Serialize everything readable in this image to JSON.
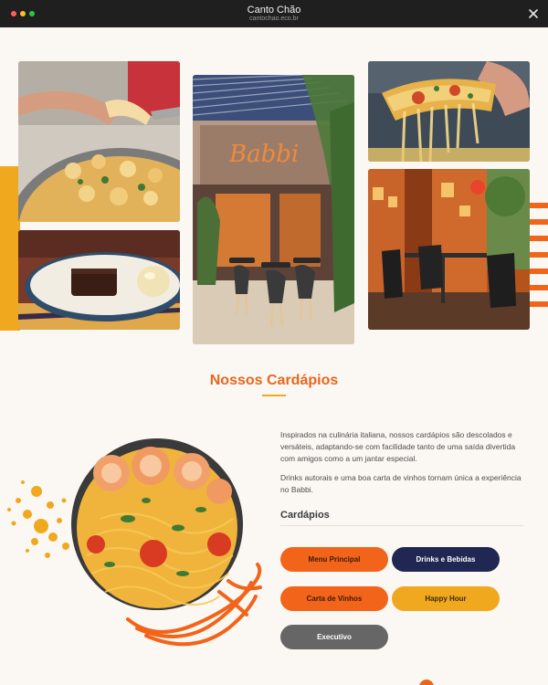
{
  "window": {
    "title": "Canto Chão",
    "url": "cantochao.eco.br"
  },
  "photos": {
    "gnocchi": "gnocchi-pan-photo",
    "dessert": "brownie-dessert-photo",
    "storefront": "babbi-storefront-photo",
    "storefront_sign": "Babbi",
    "pizza": "pizza-slice-photo",
    "interior": "restaurant-interior-photo"
  },
  "section": {
    "title": "Nossos Cardápios"
  },
  "content": {
    "paragraph1": "Inspirados na culinária italiana, nossos cardápios são descolados e versáteis, adaptando-se com facilidade tanto de uma saída divertida com amigos como a um jantar especial.",
    "paragraph2": "Drinks autorais e uma boa carta de vinhos tornam única a experiência no Babbi.",
    "menus_heading": "Cardápios"
  },
  "buttons": {
    "menu_principal": "Menu Principal",
    "drinks": "Drinks e Bebidas",
    "vinhos": "Carta de Vinhos",
    "happy_hour": "Happy Hour",
    "executivo": "Executivo"
  },
  "colors": {
    "orange": "#f26419",
    "heading": "#e8661c",
    "yellow": "#f0a81f",
    "navy": "#1f2752",
    "gray": "#666666",
    "background": "#fbf8f3"
  },
  "icons": {
    "close": "close-icon"
  }
}
